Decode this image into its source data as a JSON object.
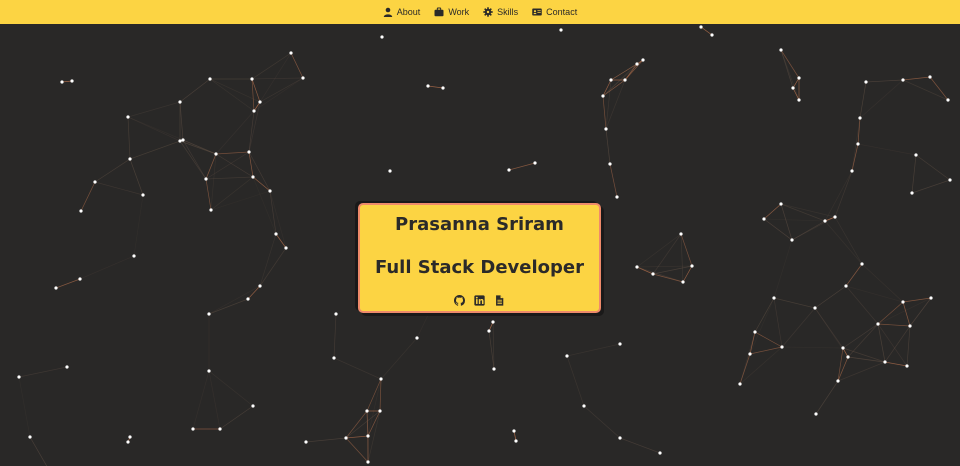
{
  "nav": {
    "items": [
      {
        "label": "About",
        "icon": "user-icon"
      },
      {
        "label": "Work",
        "icon": "briefcase-icon"
      },
      {
        "label": "Skills",
        "icon": "gear-icon"
      },
      {
        "label": "Contact",
        "icon": "id-card-icon"
      }
    ]
  },
  "hero": {
    "name": "Prasanna Sriram",
    "role": "Full Stack Developer",
    "social_icons": [
      "github-icon",
      "linkedin-icon",
      "document-icon"
    ]
  },
  "colors": {
    "accent": "#fcd443",
    "background": "#292827",
    "border": "#ef8a6a",
    "text": "#2b2a29",
    "node": "#ffffff",
    "link": "#c08060"
  }
}
